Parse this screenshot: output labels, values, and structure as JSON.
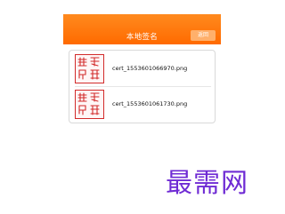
{
  "header": {
    "title": "本地签名",
    "back_label": "返回"
  },
  "list": {
    "items": [
      {
        "filename": "cert_1553601066970.png",
        "seal_text": "章列印德"
      },
      {
        "filename": "cert_1553601061730.png",
        "seal_text": "章列印德"
      }
    ]
  },
  "watermark": {
    "text": "最需网"
  },
  "colors": {
    "header_orange": "#ff7a10",
    "header_button": "#ffb06b",
    "seal_red": "#d22b2b",
    "watermark_purple": "#6f2bd4"
  }
}
